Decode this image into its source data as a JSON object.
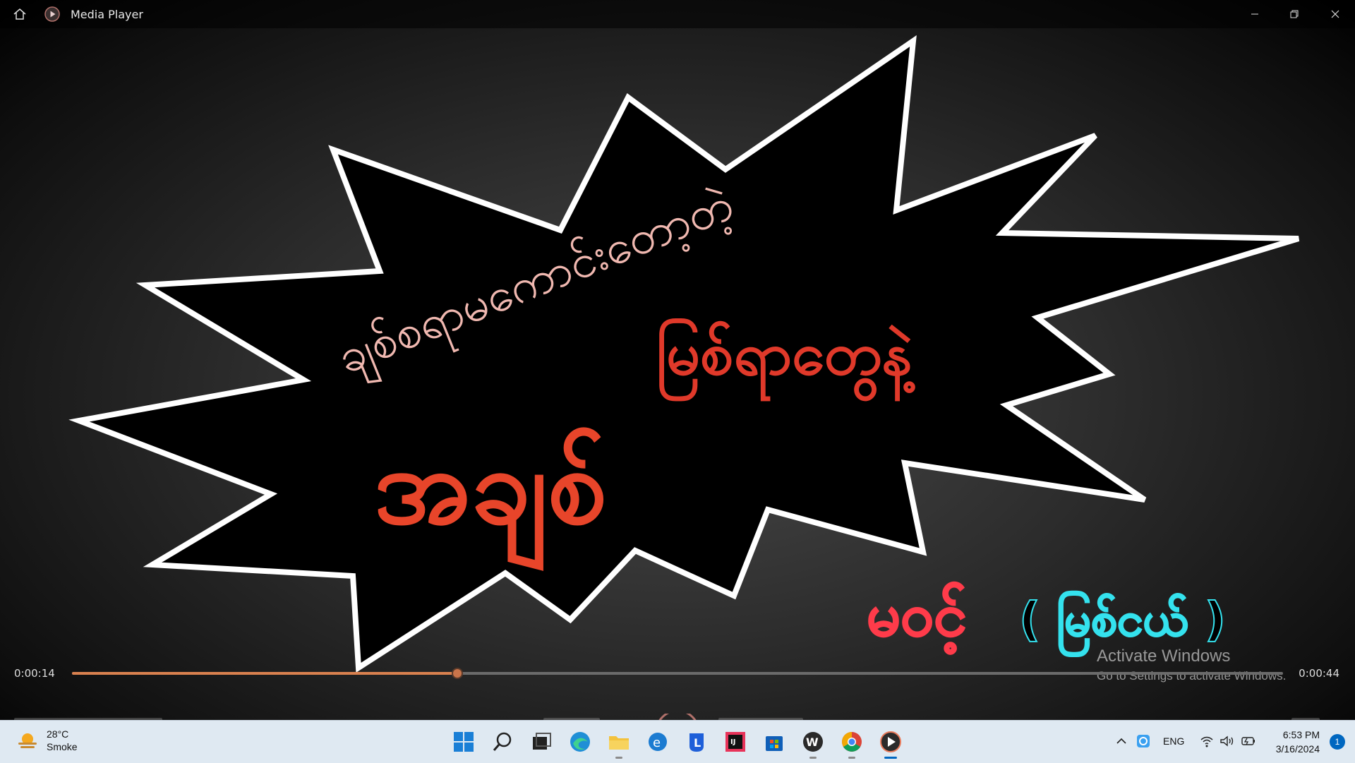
{
  "window": {
    "title": "Media Player",
    "controls": [
      "minimize",
      "restore",
      "close"
    ]
  },
  "video": {
    "line1": "ချစ်စရာမကောင်းတော့တဲ့",
    "line2": "မြစ်ရာတွေနဲ့",
    "line3": "အချစ်",
    "credit_name": "မဝင့်",
    "credit_sub": "( မြစ်ငယ် )",
    "colors": {
      "burst_fill": "#000000",
      "burst_stroke": "#ffffff",
      "text_pink": "#f0b8b0",
      "text_red": "#e8452a"
    }
  },
  "playback": {
    "current_time": "0:00:14",
    "total_time": "0:00:44",
    "progress_fraction": 0.3182,
    "accent_color": "#d9814f"
  },
  "watermark": {
    "title": "Activate Windows",
    "subtitle": "Go to Settings to activate Windows."
  },
  "taskbar": {
    "weather_temp": "28°C",
    "weather_desc": "Smoke",
    "apps": [
      "start-icon",
      "search-icon",
      "task-view-icon",
      "edge-icon",
      "file-explorer-icon",
      "edge-legacy-icon",
      "app-l-icon",
      "intellij-icon",
      "store-icon",
      "wps-icon",
      "chrome-icon",
      "media-player-icon"
    ],
    "language": "ENG",
    "time": "6:53 PM",
    "date": "3/16/2024",
    "notification_count": "1"
  }
}
